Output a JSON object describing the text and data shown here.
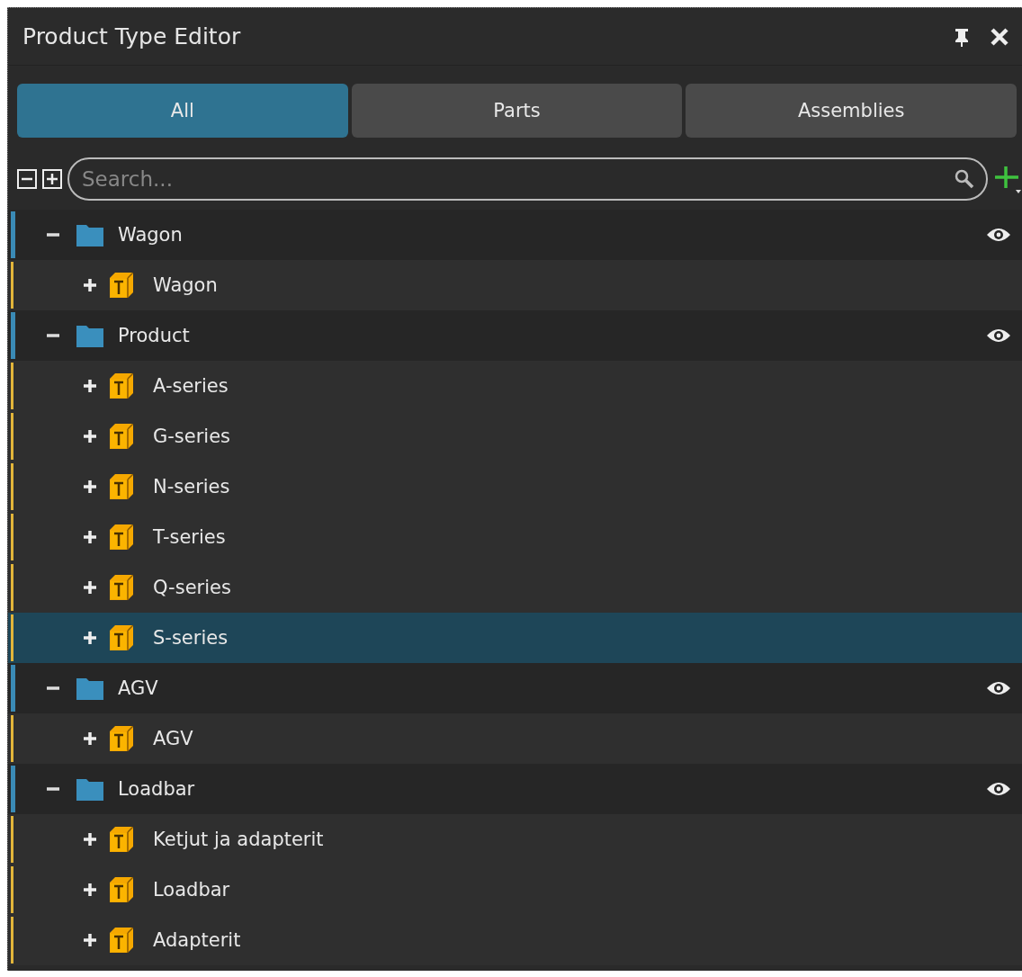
{
  "window": {
    "title": "Product Type Editor"
  },
  "tabs": [
    {
      "label": "All",
      "selected": true
    },
    {
      "label": "Parts",
      "selected": false
    },
    {
      "label": "Assemblies",
      "selected": false
    }
  ],
  "search": {
    "placeholder": "Search..."
  },
  "tree": [
    {
      "label": "Wagon",
      "expanded": true,
      "visible": true,
      "children": [
        {
          "label": "Wagon",
          "expanded": false,
          "selected": false
        }
      ]
    },
    {
      "label": "Product",
      "expanded": true,
      "visible": true,
      "children": [
        {
          "label": "A-series",
          "expanded": false,
          "selected": false
        },
        {
          "label": "G-series",
          "expanded": false,
          "selected": false
        },
        {
          "label": "N-series",
          "expanded": false,
          "selected": false
        },
        {
          "label": "T-series",
          "expanded": false,
          "selected": false
        },
        {
          "label": "Q-series",
          "expanded": false,
          "selected": false
        },
        {
          "label": "S-series",
          "expanded": false,
          "selected": true
        }
      ]
    },
    {
      "label": "AGV",
      "expanded": true,
      "visible": true,
      "children": [
        {
          "label": "AGV",
          "expanded": false,
          "selected": false
        }
      ]
    },
    {
      "label": "Loadbar",
      "expanded": true,
      "visible": true,
      "children": [
        {
          "label": "Ketjut ja adapterit",
          "expanded": false,
          "selected": false
        },
        {
          "label": "Loadbar",
          "expanded": false,
          "selected": false
        },
        {
          "label": "Adapterit",
          "expanded": false,
          "selected": false
        }
      ]
    }
  ]
}
